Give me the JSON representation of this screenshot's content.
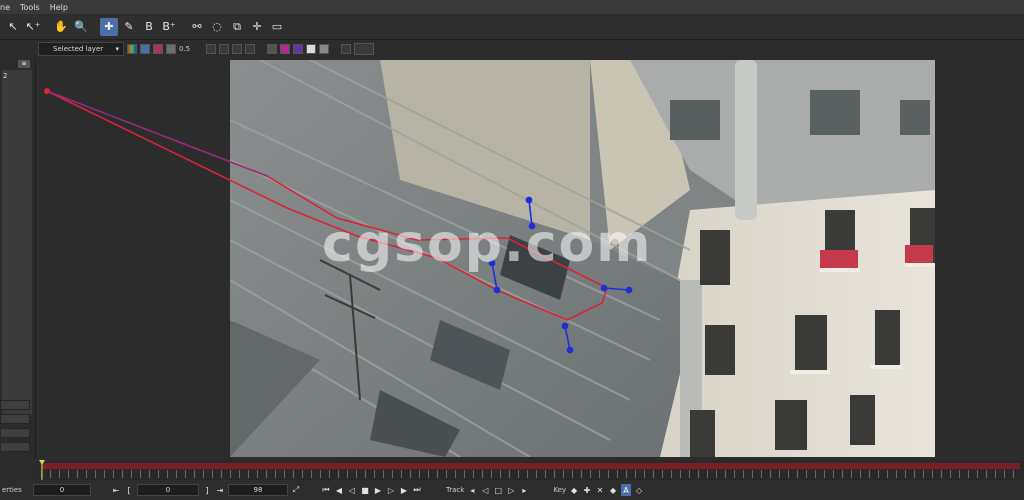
{
  "menubar": {
    "items": [
      "ne",
      "Tools",
      "Help"
    ]
  },
  "toolbar2": {
    "layer_select": "Selected layer",
    "opacity": "0.5"
  },
  "leftpanel": {
    "label": "2",
    "badge": "≡"
  },
  "watermark": "cgsop.com",
  "bottom": {
    "properties_label": "erties",
    "frame_start": "0",
    "frame_cur": "0",
    "frame_end": "98",
    "track_label": "Track",
    "key_label": "Key"
  },
  "colors": {
    "accent": "#4d6fa8",
    "spline": "#d8243a",
    "handle": "#1f2fd6",
    "timeline": "#7a1f2a"
  },
  "icons": [
    "hand-icon",
    "magnifier-icon",
    "add-point-icon",
    "transform-icon",
    "cursor-icon",
    "link-icon",
    "lasso-icon",
    "crop-icon",
    "move-icon",
    "rect-icon"
  ]
}
